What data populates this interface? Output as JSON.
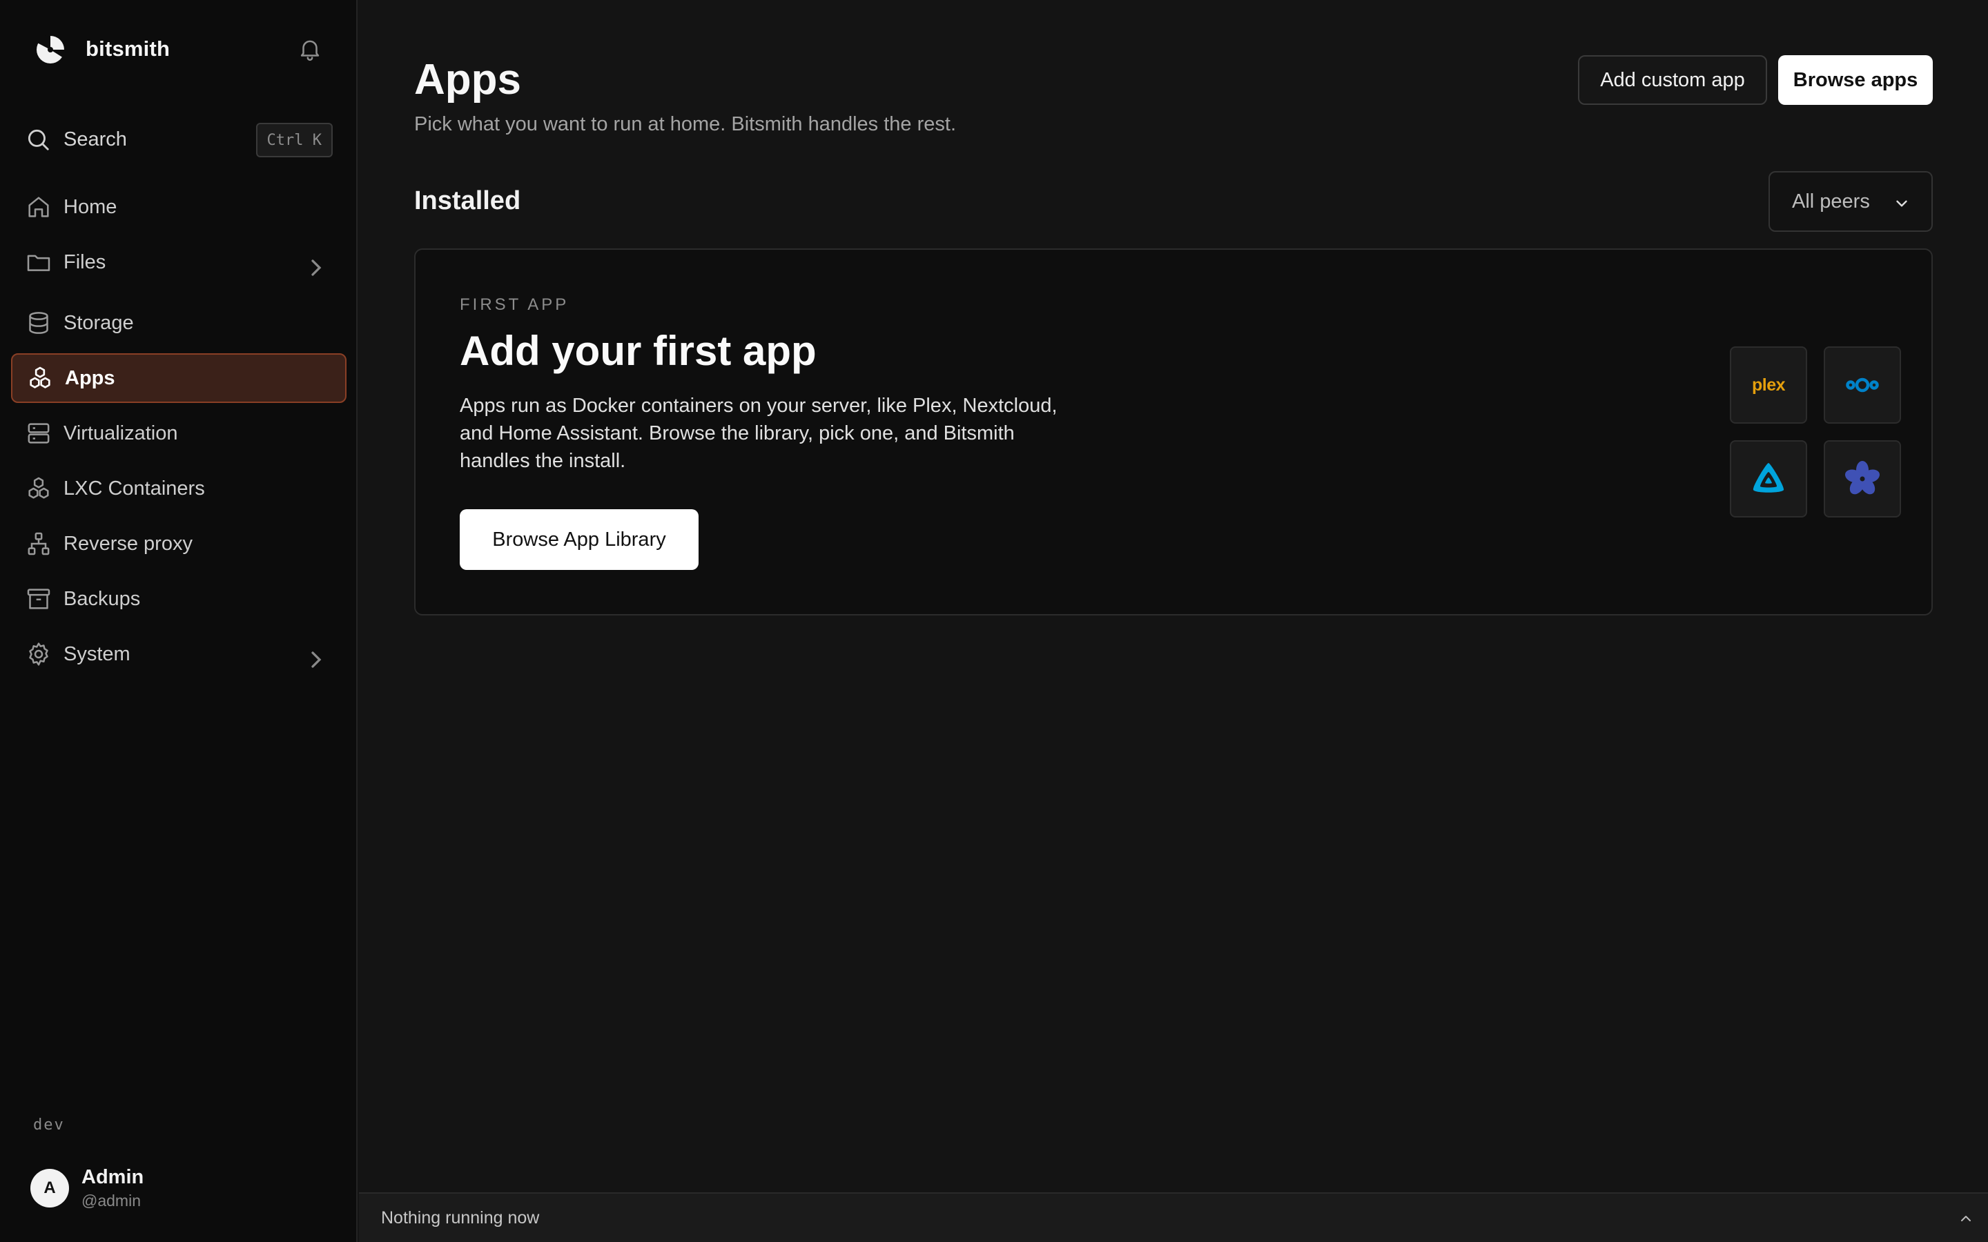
{
  "brand": {
    "name": "bitsmith"
  },
  "search": {
    "label": "Search",
    "shortcut": "Ctrl K"
  },
  "sidebar": {
    "items": [
      {
        "label": "Home",
        "icon": "home-icon"
      },
      {
        "label": "Files",
        "icon": "folder-icon",
        "expandable": true
      },
      {
        "label": "Storage",
        "icon": "database-icon"
      },
      {
        "label": "Apps",
        "icon": "apps-icon",
        "active": true
      },
      {
        "label": "Virtualization",
        "icon": "server-icon"
      },
      {
        "label": "LXC Containers",
        "icon": "containers-icon"
      },
      {
        "label": "Reverse proxy",
        "icon": "network-icon"
      },
      {
        "label": "Backups",
        "icon": "archive-icon"
      },
      {
        "label": "System",
        "icon": "gear-icon",
        "expandable": true
      }
    ],
    "env": "dev"
  },
  "user": {
    "initial": "A",
    "name": "Admin",
    "handle": "@admin"
  },
  "header": {
    "title": "Apps",
    "subtitle": "Pick what you want to run at home. Bitsmith handles the rest.",
    "add_custom_label": "Add custom app",
    "browse_label": "Browse apps"
  },
  "installed": {
    "title": "Installed",
    "filter": {
      "selected": "All peers"
    }
  },
  "empty_card": {
    "eyebrow": "FIRST APP",
    "title": "Add your first app",
    "description": "Apps run as Docker containers on your server, like Plex, Nextcloud, and Home Assistant. Browse the library, pick one, and Bitsmith handles the install.",
    "button_label": "Browse App Library",
    "tiles": [
      {
        "name": "plex",
        "icon": "plex-logo",
        "text": "plex"
      },
      {
        "name": "nextcloud",
        "icon": "nextcloud-logo"
      },
      {
        "name": "jellyfin",
        "icon": "jellyfin-logo"
      },
      {
        "name": "immich",
        "icon": "pinwheel-logo"
      }
    ]
  },
  "status_bar": {
    "text": "Nothing running now"
  },
  "colors": {
    "background": "#141414",
    "sidebar": "#0c0c0c",
    "accent_active_bg": "#3b2119",
    "accent_active_border": "#8a3f25",
    "plex": "#e5a00d",
    "nextcloud": "#0082c9",
    "jellyfin": "#00a4dc",
    "pinwheel": "#3f51b5"
  }
}
